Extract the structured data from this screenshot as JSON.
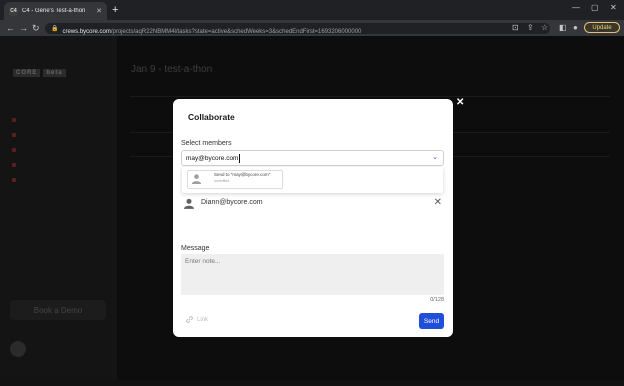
{
  "browser": {
    "tab_favicon": "C4",
    "tab_title": "C4 - Gene's Test-a-thon",
    "url_host": "crews.bycore.com",
    "url_path": "/projects/aqR22NBMM4l/tasks?state=active&schedWeeks=3&schedEndFirst=1693206000000",
    "update_label": "Update"
  },
  "app": {
    "logo": "CORE",
    "logo_badge": "beta",
    "page_title": "Jan 9 - test-a-thon",
    "book_demo": "Book a Demo"
  },
  "modal": {
    "title": "Collaborate",
    "members_label": "Select members",
    "member_input_value": "may@bycore.com",
    "suggestion_main": "Send to \"may@bycore.com\"",
    "suggestion_sub": "unverified",
    "members": [
      {
        "email": "Diann@bycore.com"
      }
    ],
    "message_label": "Message",
    "message_placeholder": "Enter note...",
    "counter": "0/128",
    "link_label": "Link",
    "send_label": "Send"
  },
  "colors": {
    "accent": "#1f4fd8",
    "backdrop": "#0d0d0d"
  }
}
